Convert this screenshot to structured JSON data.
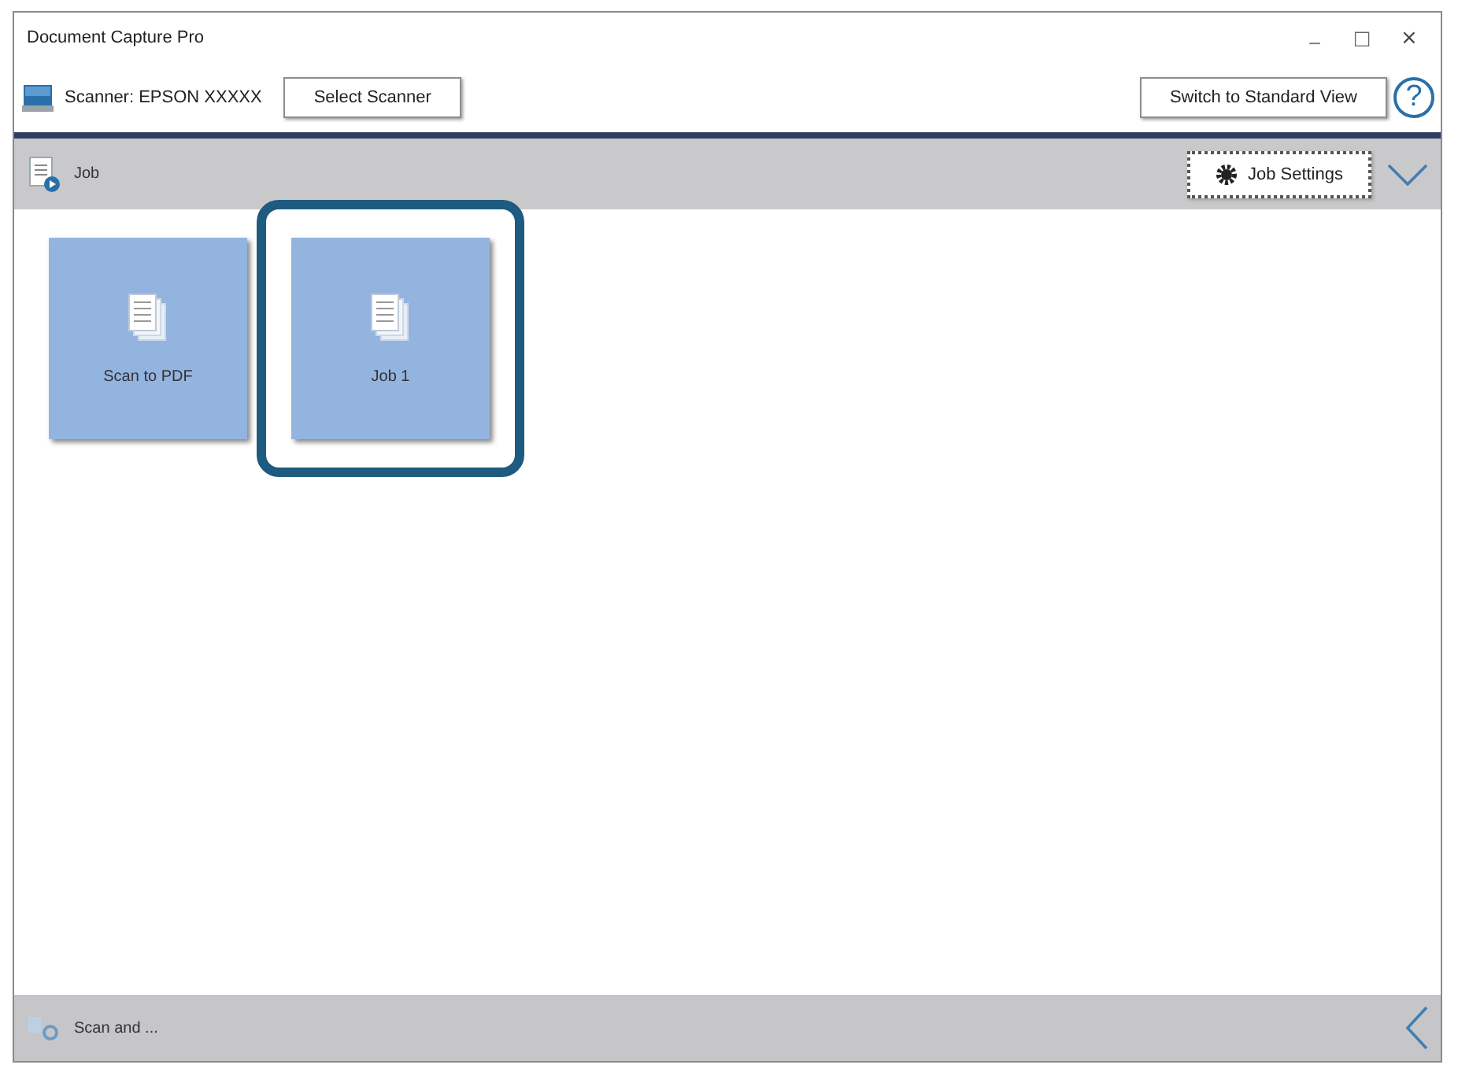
{
  "window": {
    "title": "Document Capture Pro",
    "controls": [
      {
        "kind": "minimize",
        "label": "_"
      },
      {
        "kind": "maximize",
        "label": "□"
      },
      {
        "kind": "close",
        "label": "×"
      }
    ]
  },
  "toolbar": {
    "scanner_label": "Scanner: EPSON XXXXX",
    "select_button": "Select Scanner",
    "switch_button": "Switch to Standard View",
    "help": "?"
  },
  "job_bar": {
    "title": "Job",
    "settings_button": "Job Settings"
  },
  "jobs": [
    {
      "label": "Scan to PDF",
      "highlighted": false
    },
    {
      "label": "Job 1",
      "highlighted": true
    }
  ],
  "footer": {
    "label": "Scan and ..."
  }
}
